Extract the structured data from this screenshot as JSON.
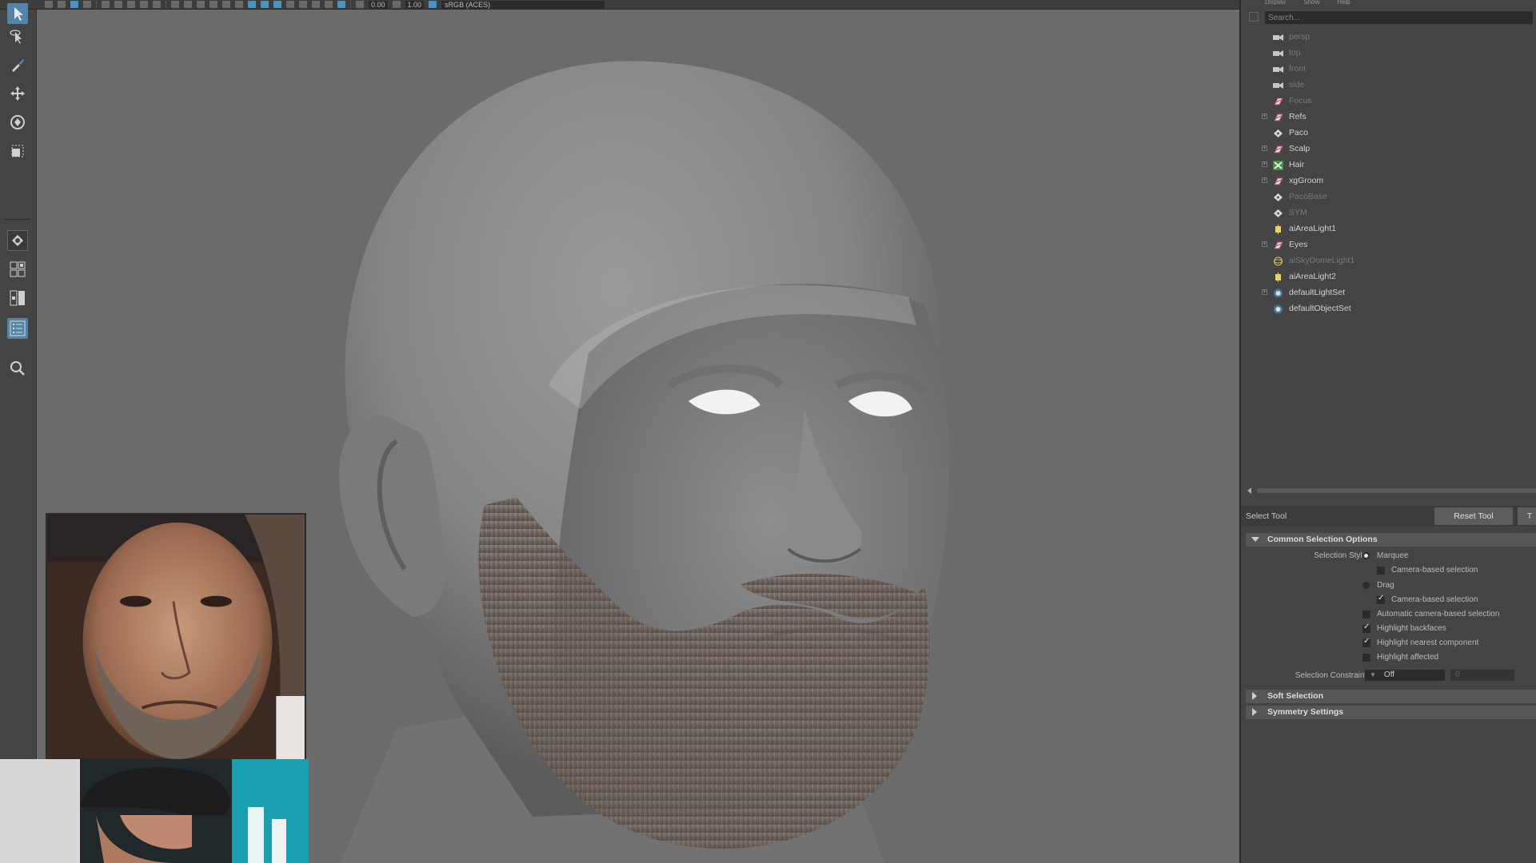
{
  "toolbar": {
    "exposure_value": "0.00",
    "gamma_value": "1.00",
    "color_space": "sRGB (ACES)"
  },
  "outliner": {
    "menu": [
      "Display",
      "Show",
      "Help"
    ],
    "search_placeholder": "Search...",
    "items": [
      {
        "label": "persp",
        "icon": "camera-icon",
        "dim": true,
        "expandable": false
      },
      {
        "label": "top",
        "icon": "camera-icon",
        "dim": true,
        "expandable": false
      },
      {
        "label": "front",
        "icon": "camera-icon",
        "dim": true,
        "expandable": false
      },
      {
        "label": "side",
        "icon": "camera-icon",
        "dim": true,
        "expandable": false
      },
      {
        "label": "Focus",
        "icon": "group-icon",
        "dim": true,
        "expandable": false
      },
      {
        "label": "Refs",
        "icon": "group-icon",
        "dim": false,
        "expandable": true
      },
      {
        "label": "Paco",
        "icon": "mesh-icon",
        "dim": false,
        "expandable": false
      },
      {
        "label": "Scalp",
        "icon": "group-icon",
        "dim": false,
        "expandable": true
      },
      {
        "label": "Hair",
        "icon": "xgen-icon",
        "dim": false,
        "expandable": true
      },
      {
        "label": "xgGroom",
        "icon": "group-icon",
        "dim": false,
        "expandable": true
      },
      {
        "label": "PacoBase",
        "icon": "mesh-icon",
        "dim": true,
        "expandable": false
      },
      {
        "label": "SYM",
        "icon": "mesh-icon",
        "dim": true,
        "expandable": false
      },
      {
        "label": "aiAreaLight1",
        "icon": "area-light-icon",
        "dim": false,
        "expandable": false
      },
      {
        "label": "Eyes",
        "icon": "group-icon",
        "dim": false,
        "expandable": true
      },
      {
        "label": "aiSkyDomeLight1",
        "icon": "skydome-icon",
        "dim": true,
        "expandable": false
      },
      {
        "label": "aiAreaLight2",
        "icon": "area-light-icon",
        "dim": false,
        "expandable": false
      },
      {
        "label": "defaultLightSet",
        "icon": "set-icon",
        "dim": false,
        "expandable": true
      },
      {
        "label": "defaultObjectSet",
        "icon": "set-icon",
        "dim": false,
        "expandable": false
      }
    ]
  },
  "tool_settings": {
    "tool_name": "Select Tool",
    "reset_label": "Reset Tool",
    "help_label": "T",
    "common": {
      "title": "Common Selection Options",
      "selection_style_label": "Selection Style:",
      "marquee_label": "Marquee",
      "marquee_selected": true,
      "marquee_camera_label": "Camera-based selection",
      "marquee_camera_checked": false,
      "drag_label": "Drag",
      "drag_selected": false,
      "drag_camera_label": "Camera-based selection",
      "drag_camera_checked": true,
      "auto_camera_label": "Automatic camera-based selection",
      "auto_camera_checked": false,
      "highlight_backfaces_label": "Highlight backfaces",
      "highlight_backfaces_checked": true,
      "highlight_nearest_label": "Highlight nearest component",
      "highlight_nearest_checked": true,
      "highlight_affected_label": "Highlight affected",
      "highlight_affected_checked": false,
      "constraint_label": "Selection Constraint:",
      "constraint_value": "Off",
      "constraint_number": "0"
    },
    "soft_selection_title": "Soft Selection",
    "symmetry_title": "Symmetry Settings"
  },
  "colors": {
    "accent": "#5285a6",
    "viewport_bg": "#6b6b6b",
    "panel_bg": "#444444"
  }
}
